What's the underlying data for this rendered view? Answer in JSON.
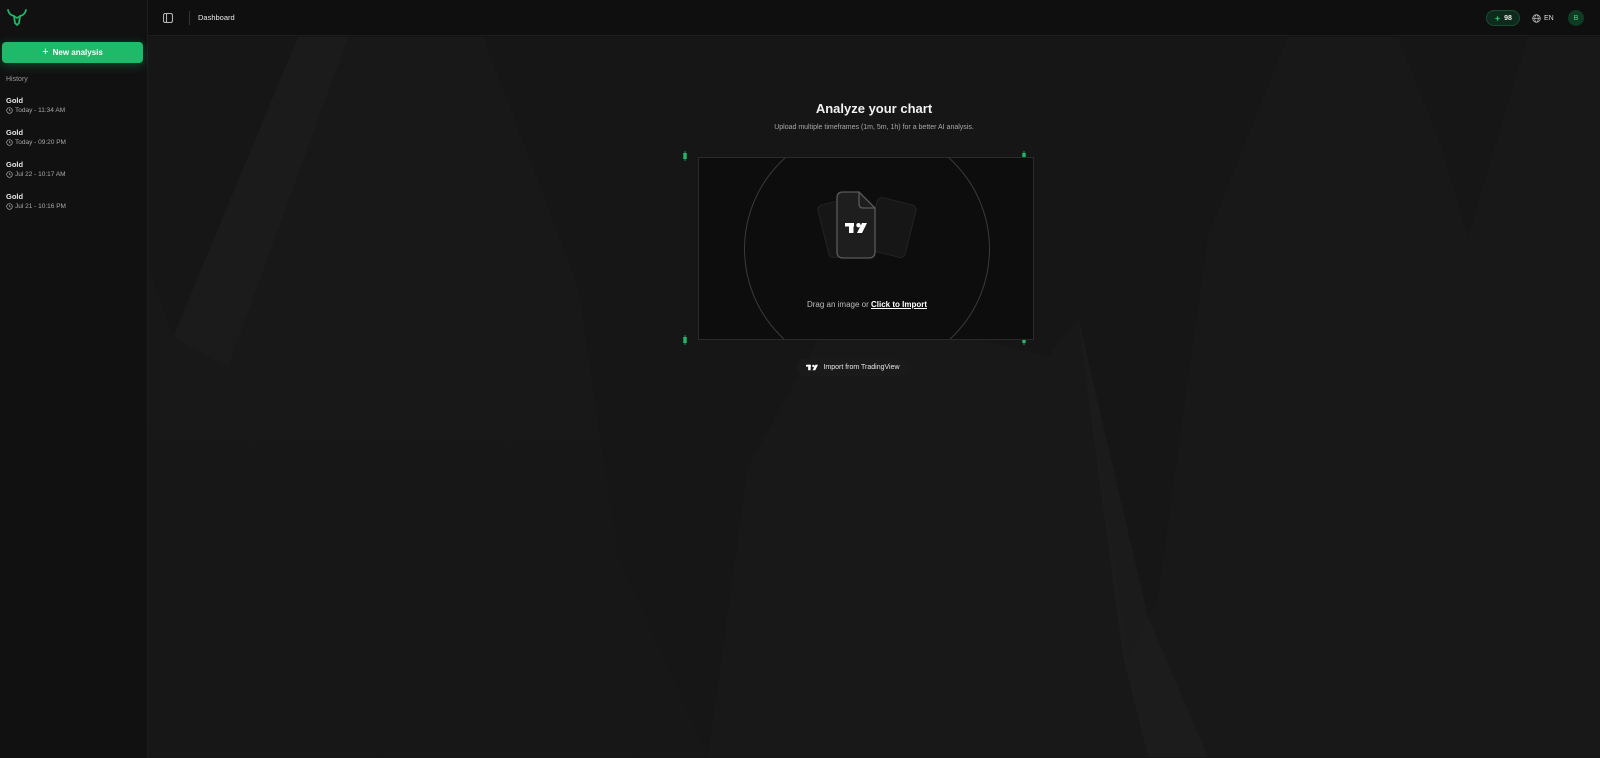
{
  "sidebar": {
    "logo": "bull-logo",
    "new_analysis_label": "New analysis",
    "history_label": "History",
    "history": [
      {
        "title": "Gold",
        "time": "Today - 11:34 AM"
      },
      {
        "title": "Gold",
        "time": "Today - 09:20 PM"
      },
      {
        "title": "Gold",
        "time": "Jul 22 - 10:17 AM"
      },
      {
        "title": "Gold",
        "time": "Jul 21 - 10:16 PM"
      }
    ]
  },
  "header": {
    "breadcrumb": "Dashboard",
    "credits": "98",
    "language": "EN",
    "avatar_initial": "B"
  },
  "main": {
    "title": "Analyze your chart",
    "subtitle": "Upload multiple timeframes (1m, 5m, 1h) for a better AI analysis.",
    "dropzone": {
      "prefix": "Drag an image or ",
      "link": "Click to Import"
    },
    "import_button": "Import from TradingView"
  },
  "colors": {
    "accent": "#1fb96a",
    "background": "#141414",
    "sidebar": "#111111"
  },
  "icons": [
    "bull-logo-icon",
    "plus-icon",
    "clock-icon",
    "panel-toggle-icon",
    "sparkle-icon",
    "globe-icon",
    "file-icon",
    "tradingview-icon"
  ]
}
